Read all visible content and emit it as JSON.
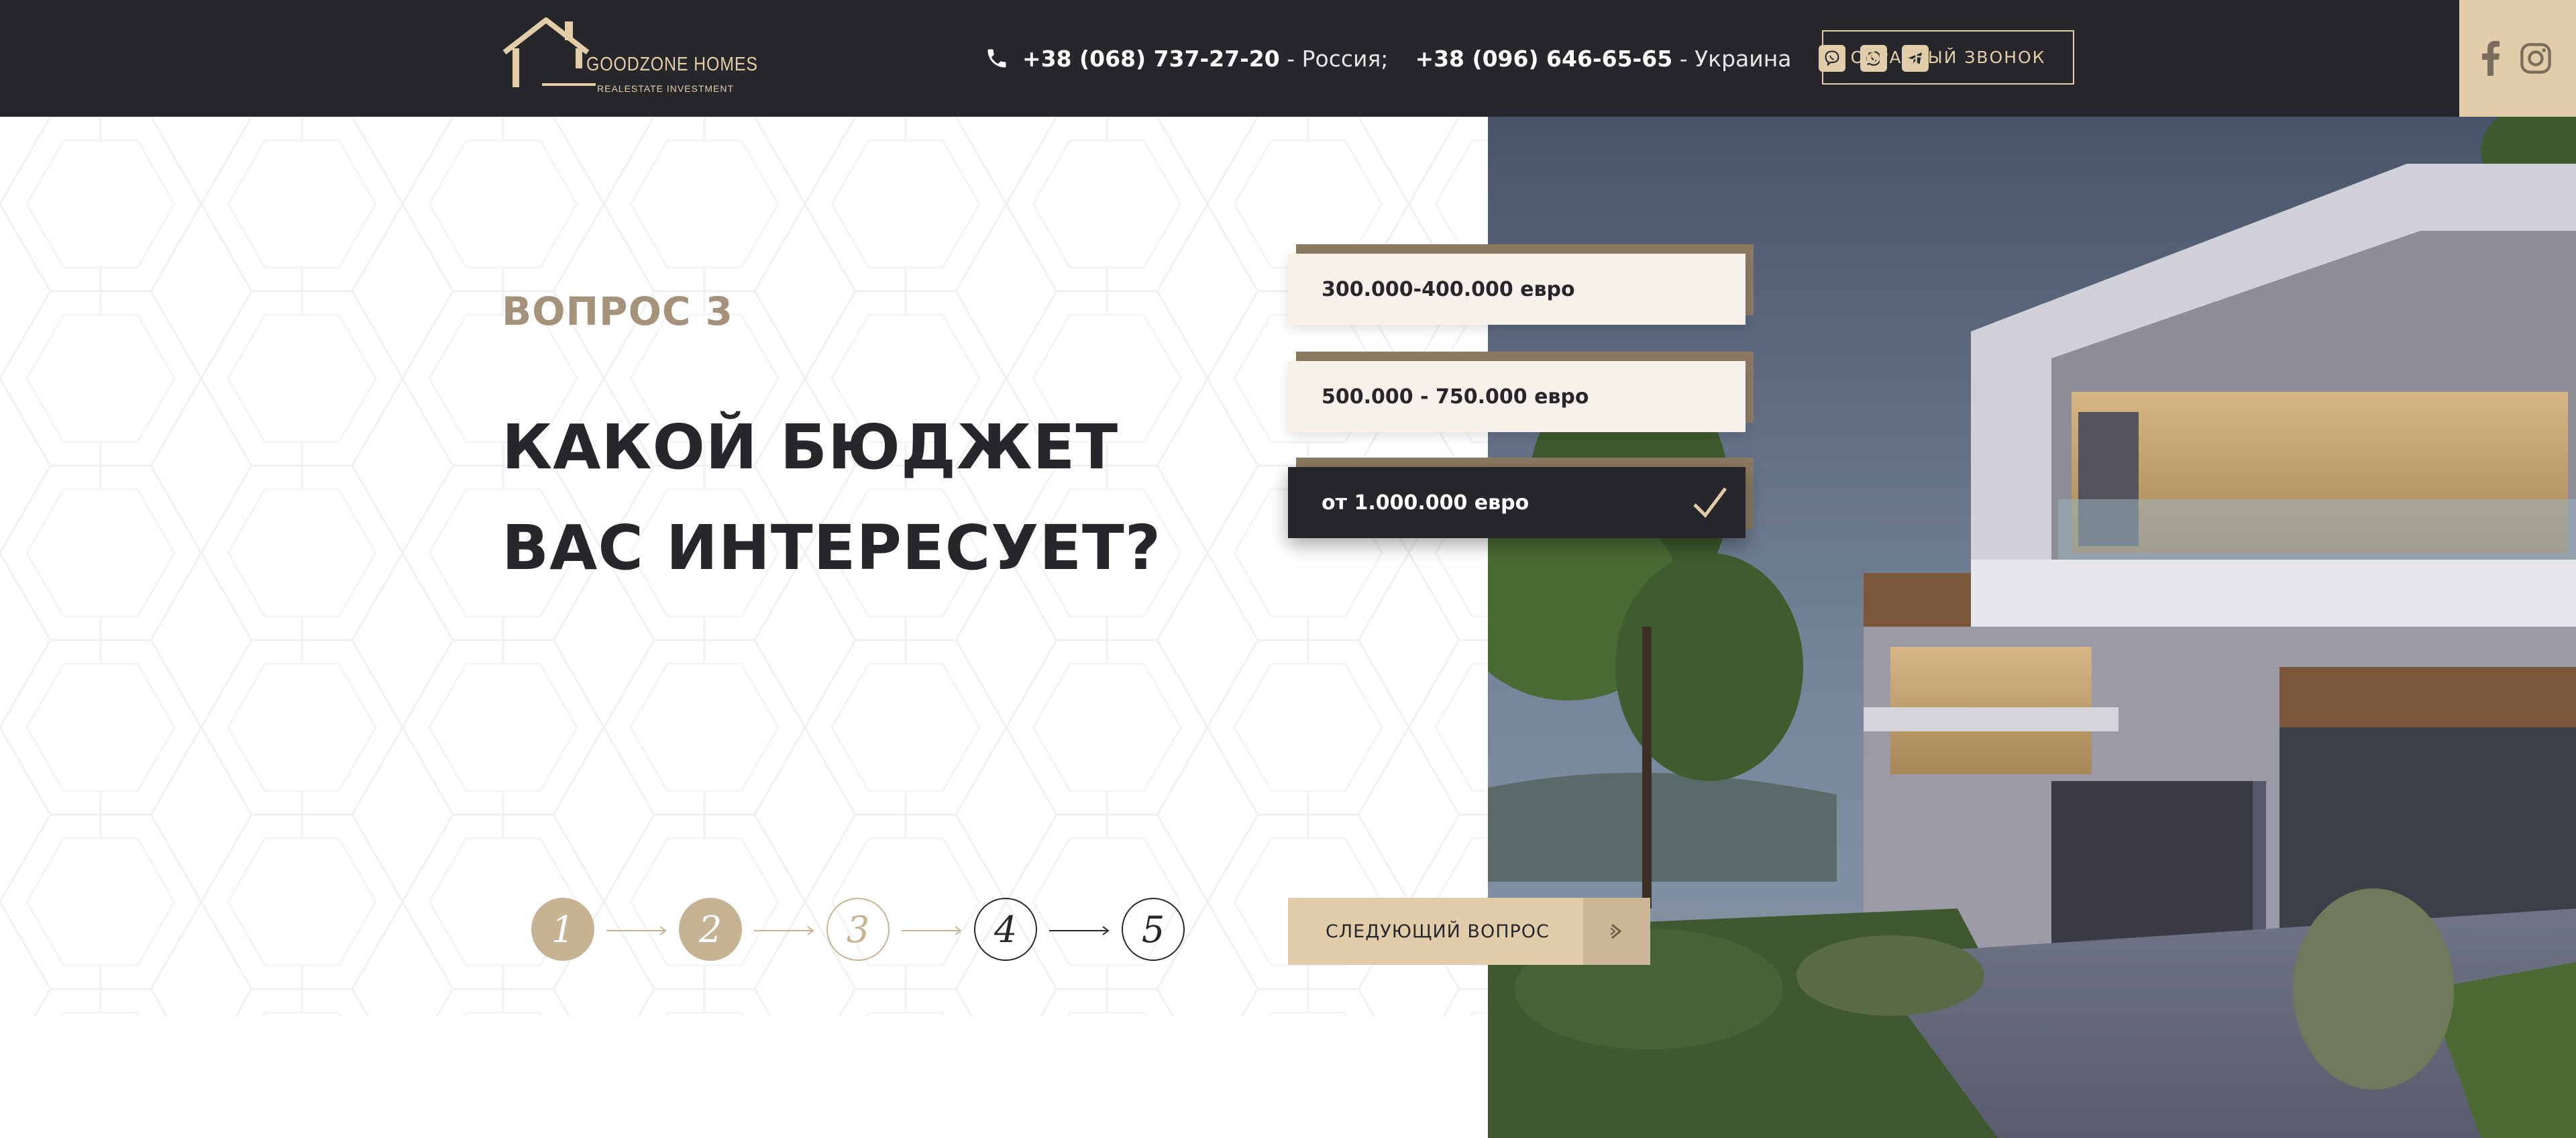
{
  "header": {
    "logo": {
      "name": "GOODZONE HOMES",
      "subtitle": "REALESTATE INVESTMENT"
    },
    "phones": [
      {
        "number": "+38 (068) 737-27-20",
        "country": "- Россия;"
      },
      {
        "number": "+38 (096) 646-65-65",
        "country": "- Украина"
      }
    ],
    "messengers": [
      "viber-icon",
      "whatsapp-icon",
      "telegram-icon"
    ],
    "callback_label": "ОБРАТНЫЙ ЗВОНОК",
    "social": [
      "facebook-icon",
      "instagram-icon"
    ]
  },
  "quiz": {
    "question_number": "ВОПРОС 3",
    "question_line1": "КАКОЙ БЮДЖЕТ",
    "question_line2": "ВАС ИНТЕРЕСУЕТ?",
    "answers": [
      {
        "label": "300.000-400.000 евро",
        "selected": false
      },
      {
        "label": "500.000 - 750.000 евро",
        "selected": false
      },
      {
        "label": "от 1.000.000 евро",
        "selected": true
      }
    ],
    "steps": [
      {
        "label": "1",
        "state": "done"
      },
      {
        "label": "2",
        "state": "done"
      },
      {
        "label": "3",
        "state": "current"
      },
      {
        "label": "4",
        "state": "todo"
      },
      {
        "label": "5",
        "state": "todo"
      }
    ],
    "next_label": "СЛЕДУЮЩИЙ ВОПРОС"
  },
  "colors": {
    "header_bg": "#27272b",
    "accent_gold": "#e1cdaa",
    "accent_dark_gold": "#a4927a",
    "text_dark": "#27272b"
  }
}
